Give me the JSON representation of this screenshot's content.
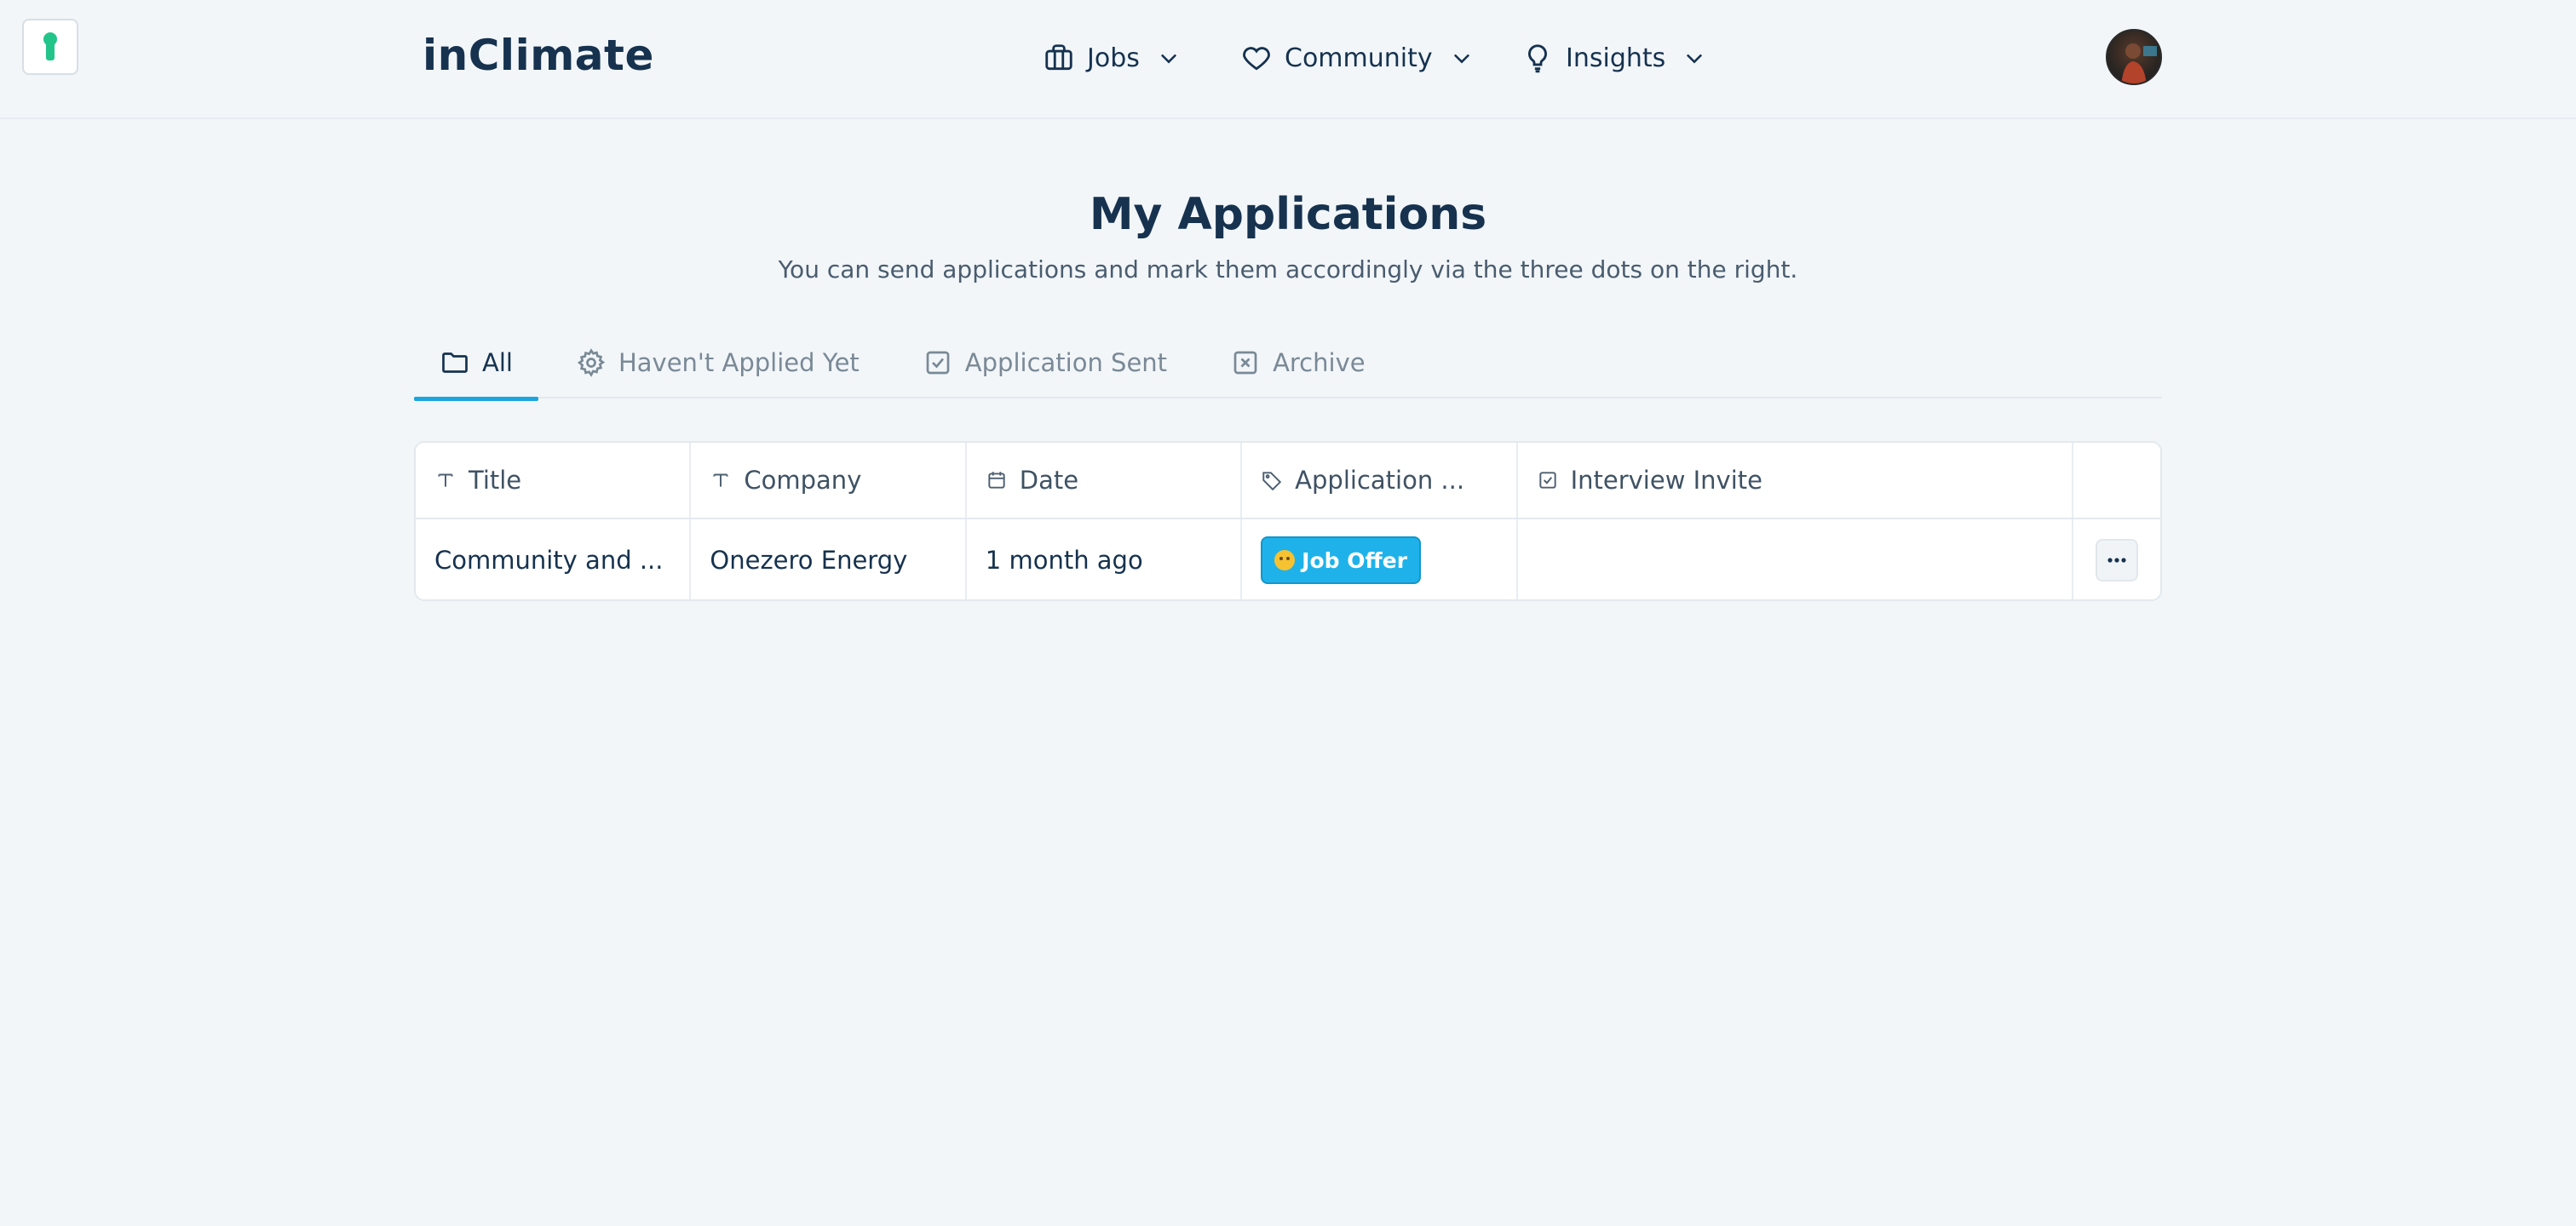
{
  "app": {
    "logo_text": "inClimate",
    "keyhole_color": "#22c48a"
  },
  "nav": [
    {
      "label": "Jobs",
      "icon": "briefcase-icon"
    },
    {
      "label": "Community",
      "icon": "heart-icon"
    },
    {
      "label": "Insights",
      "icon": "lightbulb-icon"
    }
  ],
  "page": {
    "title": "My Applications",
    "subtitle": "You can send applications and mark them accordingly via the three dots on the right."
  },
  "tabs": [
    {
      "label": "All",
      "icon": "folder-icon",
      "active": true
    },
    {
      "label": "Haven't Applied Yet",
      "icon": "gear-icon",
      "active": false
    },
    {
      "label": "Application Sent",
      "icon": "checkbox-icon",
      "active": false
    },
    {
      "label": "Archive",
      "icon": "x-box-icon",
      "active": false
    }
  ],
  "table": {
    "columns": [
      {
        "label": "Title",
        "icon": "text-icon"
      },
      {
        "label": "Company",
        "icon": "text-icon"
      },
      {
        "label": "Date",
        "icon": "calendar-icon"
      },
      {
        "label": "Application ...",
        "icon": "tag-icon"
      },
      {
        "label": "Interview Invite",
        "icon": "checkbox-icon"
      }
    ],
    "rows": [
      {
        "title": "Community and ...",
        "company": "Onezero Energy",
        "date": "1 month ago",
        "status": "Job Offer",
        "interview_invite": ""
      }
    ]
  },
  "colors": {
    "accent": "#1ca5dc",
    "badge": "#1fb2ea",
    "text": "#16324f",
    "background": "#f2f6f9"
  }
}
